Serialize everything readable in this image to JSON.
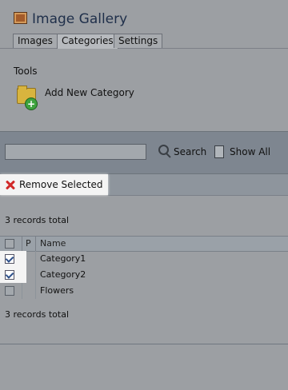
{
  "app": {
    "title": "Image Gallery"
  },
  "tabs": [
    {
      "label": "Images"
    },
    {
      "label": "Categories"
    },
    {
      "label": "Settings"
    }
  ],
  "tools": {
    "section_label": "Tools",
    "add_category_label": "Add New Category"
  },
  "search": {
    "value": "",
    "search_label": "Search",
    "show_all_label": "Show All"
  },
  "actions": {
    "remove_selected_label": "Remove Selected"
  },
  "records": {
    "total_top": "3  records total",
    "total_bottom": "3  records total"
  },
  "grid": {
    "headers": {
      "p": "P",
      "name": "Name"
    },
    "rows": [
      {
        "name": "Category1",
        "checked": true
      },
      {
        "name": "Category2",
        "checked": true
      },
      {
        "name": "Flowers",
        "checked": false
      }
    ]
  },
  "colors": {
    "accent_remove": "#d12a2a",
    "overlay": "#9c9fa3"
  }
}
